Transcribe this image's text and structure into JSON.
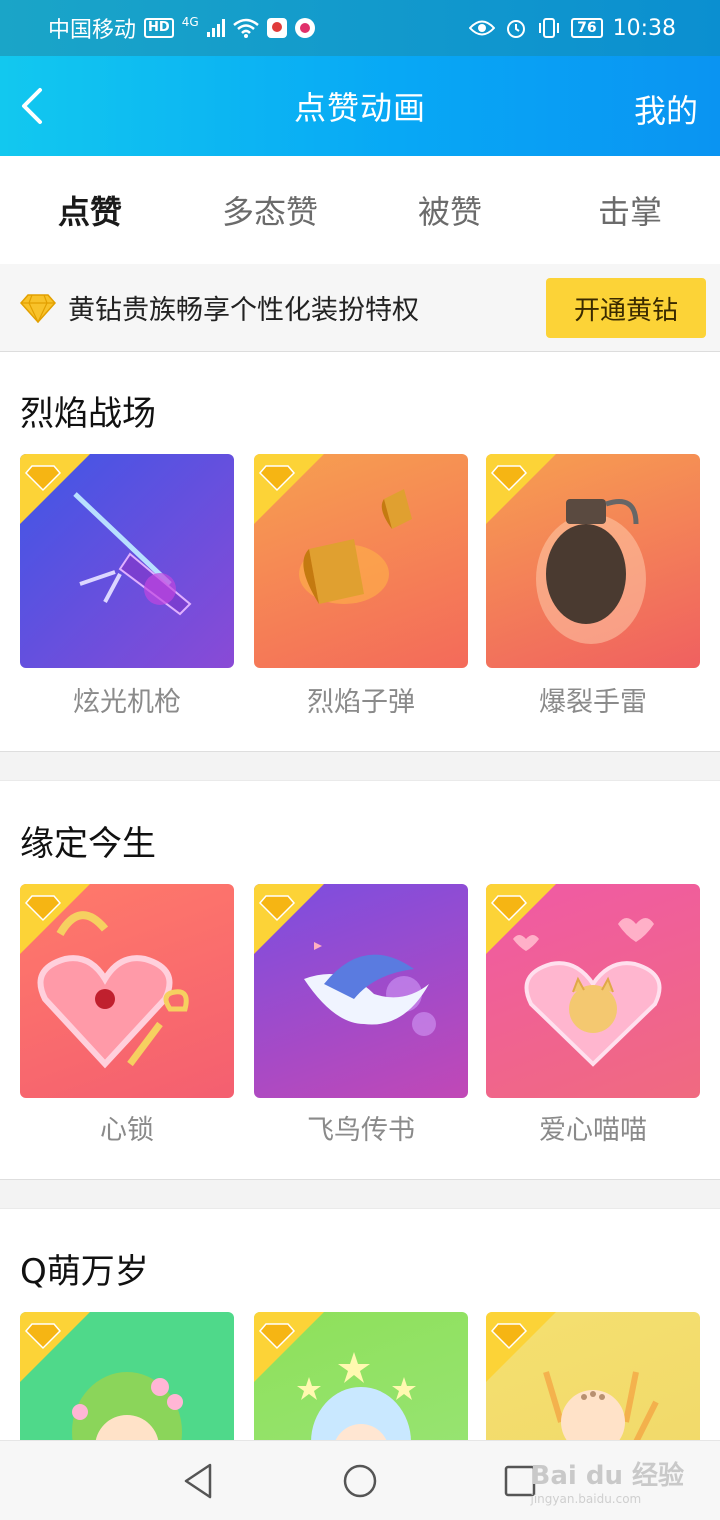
{
  "status_bar": {
    "carrier": "中国移动",
    "hd": "HD",
    "network": "4G",
    "battery": "76",
    "time": "10:38"
  },
  "header": {
    "title": "点赞动画",
    "right_link": "我的"
  },
  "tabs": [
    {
      "label": "点赞",
      "active": true
    },
    {
      "label": "多态赞",
      "active": false
    },
    {
      "label": "被赞",
      "active": false
    },
    {
      "label": "击掌",
      "active": false
    }
  ],
  "vip_banner": {
    "text": "黄钻贵族畅享个性化装扮特权",
    "button": "开通黄钻"
  },
  "sections": [
    {
      "title": "烈焰战场",
      "items": [
        {
          "label": "炫光机枪",
          "icon": "laser-gun-art",
          "colors": [
            "#3f56e6",
            "#8a4ad6"
          ]
        },
        {
          "label": "烈焰子弹",
          "icon": "fire-bullet-art",
          "colors": [
            "#f7a050",
            "#f46a5a"
          ]
        },
        {
          "label": "爆裂手雷",
          "icon": "grenade-art",
          "colors": [
            "#f7a050",
            "#f06060"
          ]
        }
      ]
    },
    {
      "title": "缘定今生",
      "items": [
        {
          "label": "心锁",
          "icon": "heart-lock-art",
          "colors": [
            "#ff7a6a",
            "#f45f70"
          ]
        },
        {
          "label": "飞鸟传书",
          "icon": "flying-bird-art",
          "colors": [
            "#7b4ee0",
            "#c148b6"
          ]
        },
        {
          "label": "爱心喵喵",
          "icon": "love-cat-art",
          "colors": [
            "#f05aa5",
            "#f06a80"
          ]
        }
      ]
    },
    {
      "title": "Q萌万岁",
      "items": [
        {
          "label": "",
          "icon": "flower-girl-art",
          "colors": [
            "#4fd98a",
            "#4fd98a"
          ]
        },
        {
          "label": "",
          "icon": "star-girl-art",
          "colors": [
            "#8ee05a",
            "#9ae57a"
          ]
        },
        {
          "label": "",
          "icon": "monk-boy-art",
          "colors": [
            "#f4e070",
            "#f1d768"
          ]
        }
      ]
    }
  ],
  "watermark": {
    "text": "Bai du 经验",
    "sub": "jingyan.baidu.com"
  },
  "accent": {
    "vip_yellow": "#fcd337",
    "header_blue": "#08a8f5"
  }
}
